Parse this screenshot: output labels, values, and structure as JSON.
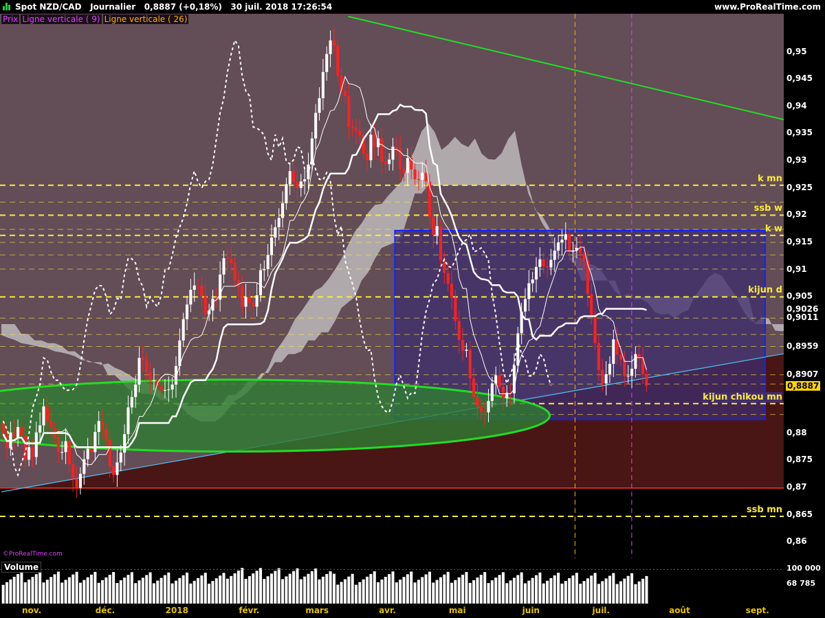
{
  "header": {
    "symbol": "Spot NZD/CAD",
    "period": "Journalier",
    "quote": "0,8887 (+0,18%)",
    "datetime": "30 juil. 2018 17:26:54",
    "source": "www.ProRealTime.com"
  },
  "legend": [
    {
      "label": "Prix",
      "color": "#e040fb"
    },
    {
      "label": "Ligne verticale ( 9)",
      "color": "#e040fb"
    },
    {
      "label": "Ligne verticale ( 26)",
      "color": "#ffb300"
    }
  ],
  "watermark": "©ProRealTime.com",
  "chart_data": {
    "type": "candlestick",
    "title": "",
    "price_axis": {
      "ylim": [
        0.857,
        0.957
      ],
      "ticks": [
        {
          "v": 0.95,
          "label": "0,95"
        },
        {
          "v": 0.945,
          "label": "0,945"
        },
        {
          "v": 0.94,
          "label": "0,94"
        },
        {
          "v": 0.935,
          "label": "0,935"
        },
        {
          "v": 0.93,
          "label": "0,93"
        },
        {
          "v": 0.925,
          "label": "0,925"
        },
        {
          "v": 0.92,
          "label": "0,92"
        },
        {
          "v": 0.915,
          "label": "0,915"
        },
        {
          "v": 0.91,
          "label": "0,91"
        },
        {
          "v": 0.905,
          "label": "0,905"
        },
        {
          "v": 0.88,
          "label": "0,88"
        },
        {
          "v": 0.875,
          "label": "0,875"
        },
        {
          "v": 0.87,
          "label": "0,87"
        },
        {
          "v": 0.865,
          "label": "0,865"
        },
        {
          "v": 0.86,
          "label": "0,86"
        }
      ],
      "tags": [
        {
          "v": 0.9026,
          "label": "0,9026",
          "bg": "#000000",
          "fg": "#ffffff"
        },
        {
          "v": 0.9011,
          "label": "0,9011",
          "bg": "#000000",
          "fg": "#ffffff"
        },
        {
          "v": 0.8959,
          "label": "0,8959",
          "bg": "#000000",
          "fg": "#ffffff"
        },
        {
          "v": 0.8907,
          "label": "0,8907",
          "bg": "#000000",
          "fg": "#ffffff"
        },
        {
          "v": 0.8887,
          "label": "0,8887",
          "bg": "#ffd400",
          "fg": "#000000"
        }
      ]
    },
    "months": [
      {
        "label": "nov.",
        "i": 0
      },
      {
        "label": "déc.",
        "i": 22
      },
      {
        "label": "2018",
        "i": 43
      },
      {
        "label": "févr.",
        "i": 65
      },
      {
        "label": "mars",
        "i": 85
      },
      {
        "label": "avr.",
        "i": 107
      },
      {
        "label": "mai",
        "i": 128
      },
      {
        "label": "juin",
        "i": 150
      },
      {
        "label": "juil.",
        "i": 171
      },
      {
        "label": "août",
        "i": 194
      },
      {
        "label": "sept.",
        "i": 217
      }
    ],
    "x_count": 235,
    "close": [
      0.8798,
      0.8772,
      0.8801,
      0.8791,
      0.8811,
      0.8795,
      0.8751,
      0.8774,
      0.8756,
      0.8801,
      0.8814,
      0.8849,
      0.8822,
      0.881,
      0.8791,
      0.8765,
      0.8765,
      0.8785,
      0.8743,
      0.8716,
      0.8699,
      0.8725,
      0.8752,
      0.8771,
      0.8765,
      0.8802,
      0.8822,
      0.8807,
      0.8788,
      0.8739,
      0.8723,
      0.8746,
      0.8764,
      0.8798,
      0.8847,
      0.8866,
      0.8889,
      0.8938,
      0.8934,
      0.8912,
      0.8897,
      0.8897,
      0.8886,
      0.8878,
      0.8879,
      0.888,
      0.8889,
      0.8923,
      0.897,
      0.9009,
      0.9036,
      0.9063,
      0.9071,
      0.907,
      0.9051,
      0.9018,
      0.9025,
      0.9047,
      0.9045,
      0.9091,
      0.9121,
      0.912,
      0.9112,
      0.9081,
      0.9069,
      0.9032,
      0.905,
      0.9039,
      0.9032,
      0.9053,
      0.9099,
      0.9101,
      0.9127,
      0.9159,
      0.9178,
      0.9195,
      0.9222,
      0.9257,
      0.9281,
      0.9261,
      0.925,
      0.9262,
      0.9266,
      0.9293,
      0.9341,
      0.9388,
      0.9415,
      0.9463,
      0.9496,
      0.9521,
      0.9511,
      0.9456,
      0.9428,
      0.9419,
      0.9362,
      0.936,
      0.9355,
      0.9347,
      0.9313,
      0.9301,
      0.9348,
      0.9325,
      0.9341,
      0.9299,
      0.9294,
      0.9302,
      0.9326,
      0.9322,
      0.9285,
      0.9278,
      0.9305,
      0.9284,
      0.9266,
      0.9265,
      0.9278,
      0.9262,
      0.9197,
      0.9164,
      0.918,
      0.9117,
      0.9094,
      0.9074,
      0.9049,
      0.9006,
      0.8971,
      0.8951,
      0.8953,
      0.89,
      0.8866,
      0.8849,
      0.884,
      0.8838,
      0.8859,
      0.8891,
      0.8906,
      0.8885,
      0.8864,
      0.8874,
      0.8873,
      0.8924,
      0.8983,
      0.9023,
      0.9046,
      0.9075,
      0.9082,
      0.9105,
      0.9119,
      0.9106,
      0.9104,
      0.9118,
      0.9135,
      0.915,
      0.9155,
      0.9165,
      0.9133,
      0.9135,
      0.914,
      0.913,
      0.9117,
      0.9055,
      0.9017,
      0.8965,
      0.8916,
      0.8891,
      0.8908,
      0.8927,
      0.8972,
      0.8944,
      0.8935,
      0.8905,
      0.8905,
      0.8918,
      0.8945,
      0.8937,
      0.8908,
      0.8887
    ],
    "tenkan_kijun_note": "",
    "cloud_a": [
      0.898,
      0.8975,
      0.8971,
      0.8965,
      0.8963,
      0.896,
      0.8958,
      0.8955,
      0.895,
      0.8948,
      0.8945,
      0.8941,
      0.8934,
      0.8933,
      0.8929,
      0.8925,
      0.8928,
      0.892,
      0.8915,
      0.8908,
      0.89,
      0.8896,
      0.8891,
      0.8888,
      0.8874,
      0.8863,
      0.8853,
      0.8847,
      0.8834,
      0.8826,
      0.8821,
      0.8821,
      0.8821,
      0.8829,
      0.8844,
      0.8859,
      0.8866,
      0.8876,
      0.889,
      0.8901,
      0.892,
      0.8949,
      0.8965,
      0.8984,
      0.9009,
      0.9024,
      0.9042,
      0.9061,
      0.9068,
      0.9082,
      0.91,
      0.912,
      0.9146,
      0.917,
      0.9185,
      0.9205,
      0.9219,
      0.9221,
      0.9236,
      0.9249,
      0.9262,
      0.9295,
      0.9321,
      0.9354,
      0.9369,
      0.9352,
      0.932,
      0.933,
      0.9344,
      0.9331,
      0.9325,
      0.9341,
      0.9313,
      0.9303,
      0.9302,
      0.9314,
      0.934,
      0.9355,
      0.9292,
      0.924,
      0.9213,
      0.9187,
      0.9167,
      0.9137,
      0.9118,
      0.912,
      0.9125,
      0.9121,
      0.9112,
      0.9107,
      0.9097,
      0.9079,
      0.906,
      0.905,
      0.9056,
      0.9045,
      0.9046,
      0.9038,
      0.9022,
      0.9017,
      0.9019,
      0.9011,
      0.9021,
      0.9026,
      0.9052,
      0.9068,
      0.9086,
      0.9094,
      0.9089,
      0.907,
      0.9054,
      0.9029,
      0.901,
      0.9002,
      0.9011,
      0.9011,
      0.8988,
      0.8987,
      0.8989,
      0.8977,
      0.8962
    ],
    "cloud_b": [
      0.9,
      0.9,
      0.9,
      0.8982,
      0.8982,
      0.897,
      0.897,
      0.8965,
      0.8965,
      0.896,
      0.895,
      0.895,
      0.894,
      0.893,
      0.893,
      0.893,
      0.8906,
      0.8906,
      0.8895,
      0.888,
      0.8877,
      0.8872,
      0.8872,
      0.887,
      0.886,
      0.886,
      0.8855,
      0.8855,
      0.885,
      0.885,
      0.885,
      0.885,
      0.885,
      0.885,
      0.887,
      0.887,
      0.888,
      0.8895,
      0.8895,
      0.891,
      0.891,
      0.893,
      0.893,
      0.8945,
      0.8945,
      0.895,
      0.897,
      0.897,
      0.8985,
      0.8985,
      0.9005,
      0.903,
      0.904,
      0.905,
      0.908,
      0.9095,
      0.912,
      0.914,
      0.9145,
      0.915,
      0.916,
      0.92,
      0.924,
      0.924,
      0.9255,
      0.9255,
      0.9255,
      0.9255,
      0.9255,
      0.9255,
      0.9255,
      0.9255,
      0.9255,
      0.9255,
      0.9255,
      0.9255,
      0.9255,
      0.9255,
      0.9255,
      0.9255,
      0.921,
      0.92,
      0.918,
      0.915,
      0.912,
      0.912,
      0.911,
      0.908,
      0.908,
      0.908,
      0.908,
      0.908,
      0.908,
      0.905,
      0.905,
      0.905,
      0.905,
      0.905,
      0.905,
      0.905,
      0.905,
      0.905,
      0.905,
      0.905,
      0.905,
      0.905,
      0.905,
      0.905,
      0.905,
      0.905,
      0.905,
      0.905,
      0.905,
      0.9,
      0.9,
      0.9,
      0.9,
      0.9,
      0.9,
      0.9,
      0.9
    ],
    "cloud_start": 0,
    "hlines": [
      {
        "v": 0.9255,
        "label": "k mn",
        "style": "dash"
      },
      {
        "v": 0.9224,
        "label": "",
        "style": "dash"
      },
      {
        "v": 0.92,
        "label": "ssb w",
        "style": "dash"
      },
      {
        "v": 0.9174,
        "label": "",
        "style": "dash"
      },
      {
        "v": 0.9163,
        "label": "k w",
        "style": "dash"
      },
      {
        "v": 0.915,
        "label": "",
        "style": "dash"
      },
      {
        "v": 0.9127,
        "label": "",
        "style": "dash"
      },
      {
        "v": 0.9101,
        "label": "",
        "style": "dash"
      },
      {
        "v": 0.905,
        "label": "kijun d",
        "style": "dash"
      },
      {
        "v": 0.9011,
        "label": "",
        "style": "dash"
      },
      {
        "v": 0.8981,
        "label": "",
        "style": "dash"
      },
      {
        "v": 0.8959,
        "label": "",
        "style": "dash"
      },
      {
        "v": 0.8907,
        "label": "",
        "style": "dash"
      },
      {
        "v": 0.889,
        "label": "",
        "style": "dash"
      },
      {
        "v": 0.8854,
        "label": "kijun chikou mn",
        "style": "dash"
      },
      {
        "v": 0.8834,
        "label": "",
        "style": "dash"
      },
      {
        "v": 0.8699,
        "label": "",
        "style": "solid-red"
      },
      {
        "v": 0.8647,
        "label": "ssb mn",
        "style": "dash"
      }
    ],
    "vlines": [
      {
        "i": 172,
        "color": "#ffb300"
      },
      {
        "i": 189,
        "color": "#e040fb"
      }
    ],
    "trendline_green": {
      "i0": 104,
      "v0": 0.9565,
      "i1": 235,
      "v1": 0.9375
    },
    "trendline_blue": {
      "i0": 0,
      "v0": 0.8692,
      "i1": 235,
      "v1": 0.8946
    },
    "box": {
      "i0": 118,
      "i1": 229,
      "v0": 0.9172,
      "v1": 0.8825
    },
    "ellipse": {
      "i": 69,
      "v": 0.8832,
      "ri": 18,
      "rv": 0.0066
    },
    "volume": {
      "title": "Volume",
      "labels": [
        {
          "v": 100000,
          "label": "100 000"
        },
        {
          "v": 68785,
          "label": "68 785"
        }
      ],
      "ymax": 125000
    },
    "colors": {
      "bg_upper": "#634d57",
      "bg_lower": "#4a1515",
      "bg_below": "#000000",
      "box_fill": "#3f2d6e",
      "candle_up": "#ffffff",
      "candle_down": "#ff2020",
      "cloud": "#c8c8c8",
      "hline": "#ffeb3b",
      "trend_green": "#22dd22",
      "trend_blue": "#4fc3f7",
      "box_border": "#1020ff",
      "ellipse": "#22dd22",
      "red_line": "#ff3030"
    }
  }
}
